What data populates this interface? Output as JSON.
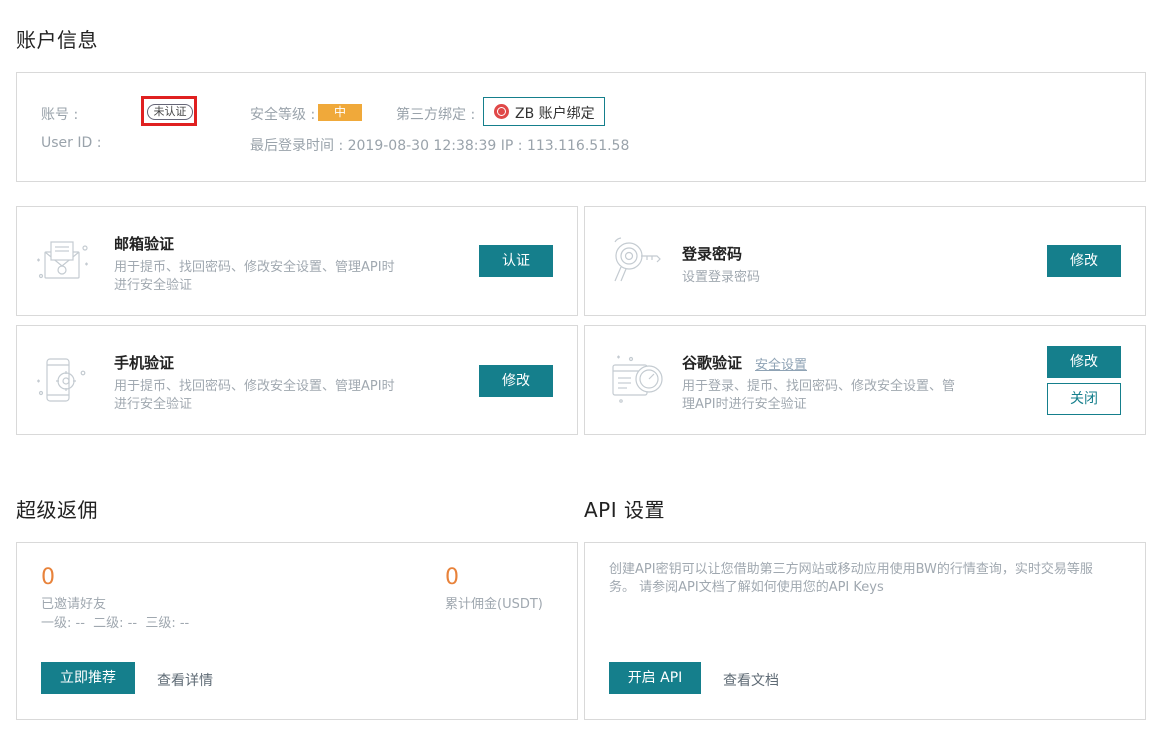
{
  "account": {
    "section_title": "账户信息",
    "account_label": "账号 :",
    "unverified_badge": "未认证",
    "userid_label": "User ID :",
    "security_level_label": "安全等级 :",
    "security_level_value": "中",
    "third_party_label": "第三方绑定 :",
    "bind_button": "ZB 账户绑定",
    "last_login": "最后登录时间 : 2019-08-30 12:38:39 IP : 113.116.51.58"
  },
  "cards": {
    "email": {
      "title": "邮箱验证",
      "desc_line1": "用于提币、找回密码、修改安全设置、管理API时",
      "desc_line2": "进行安全验证",
      "button": "认证"
    },
    "login_password": {
      "title": "登录密码",
      "desc": "设置登录密码",
      "button": "修改"
    },
    "phone": {
      "title": "手机验证",
      "desc_line1": "用于提币、找回密码、修改安全设置、管理API时",
      "desc_line2": "进行安全验证",
      "button": "修改"
    },
    "google": {
      "title": "谷歌验证",
      "link": "安全设置",
      "desc_line1": "用于登录、提币、找回密码、修改安全设置、管",
      "desc_line2": "理API时进行安全验证",
      "button_modify": "修改",
      "button_close": "关闭"
    }
  },
  "rebate": {
    "section_title": "超级返佣",
    "invited_count": "0",
    "invited_label": "已邀请好友",
    "levels": "一级: --  二级: --  三级: --",
    "commission_value": "0",
    "commission_label": "累计佣金(USDT)",
    "recommend_button": "立即推荐",
    "details_link": "查看详情"
  },
  "api": {
    "section_title": "API 设置",
    "desc_line1": "创建API密钥可以让您借助第三方网站或移动应用使用BW的行情查询，实时交易等服",
    "desc_line2": "务。 请参阅API文档了解如何使用您的API Keys",
    "open_button": "开启 API",
    "docs_link": "查看文档"
  },
  "colors": {
    "accent": "#157f8c",
    "warning": "#f0a93a",
    "highlight_red": "#e02020",
    "number_orange": "#e8823a"
  }
}
